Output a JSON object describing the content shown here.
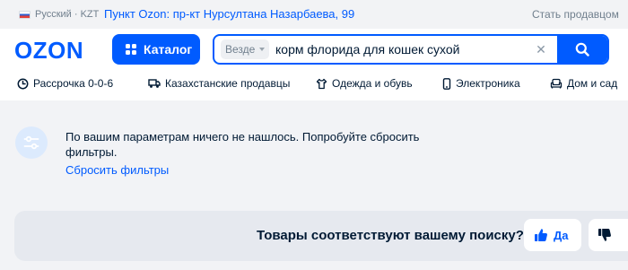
{
  "topbar": {
    "language": "Русский · KZT",
    "pickup_point": "Пункт Ozon: пр-кт Нурсултана Назарбаева, 99",
    "become_seller": "Стать продавцом"
  },
  "header": {
    "logo": "OZON",
    "catalog_label": "Каталог",
    "search": {
      "scope": "Везде",
      "query": "корм флорида для кошек сухой",
      "clear_symbol": "✕"
    }
  },
  "nav": {
    "items": [
      {
        "label": "Рассрочка 0-0-6",
        "icon": "installment-icon"
      },
      {
        "label": "Казахстанские продавцы",
        "icon": "truck-icon"
      },
      {
        "label": "Одежда и обувь",
        "icon": "clothes-icon"
      },
      {
        "label": "Электроника",
        "icon": "phone-icon"
      },
      {
        "label": "Дом и сад",
        "icon": "sofa-icon"
      }
    ]
  },
  "empty_state": {
    "message": "По вашим параметрам ничего не нашлось. Попробуйте сбросить фильтры.",
    "reset_link": "Сбросить фильтры",
    "icon": "filter-sliders-icon"
  },
  "feedback": {
    "question": "Товары соответствуют вашему поиску?",
    "yes_label": "Да"
  },
  "colors": {
    "accent": "#005bff",
    "page_background": "#f2f3f6",
    "feedback_background": "#e6e9ef",
    "text": "#001a34",
    "muted_text": "#707f8d"
  }
}
